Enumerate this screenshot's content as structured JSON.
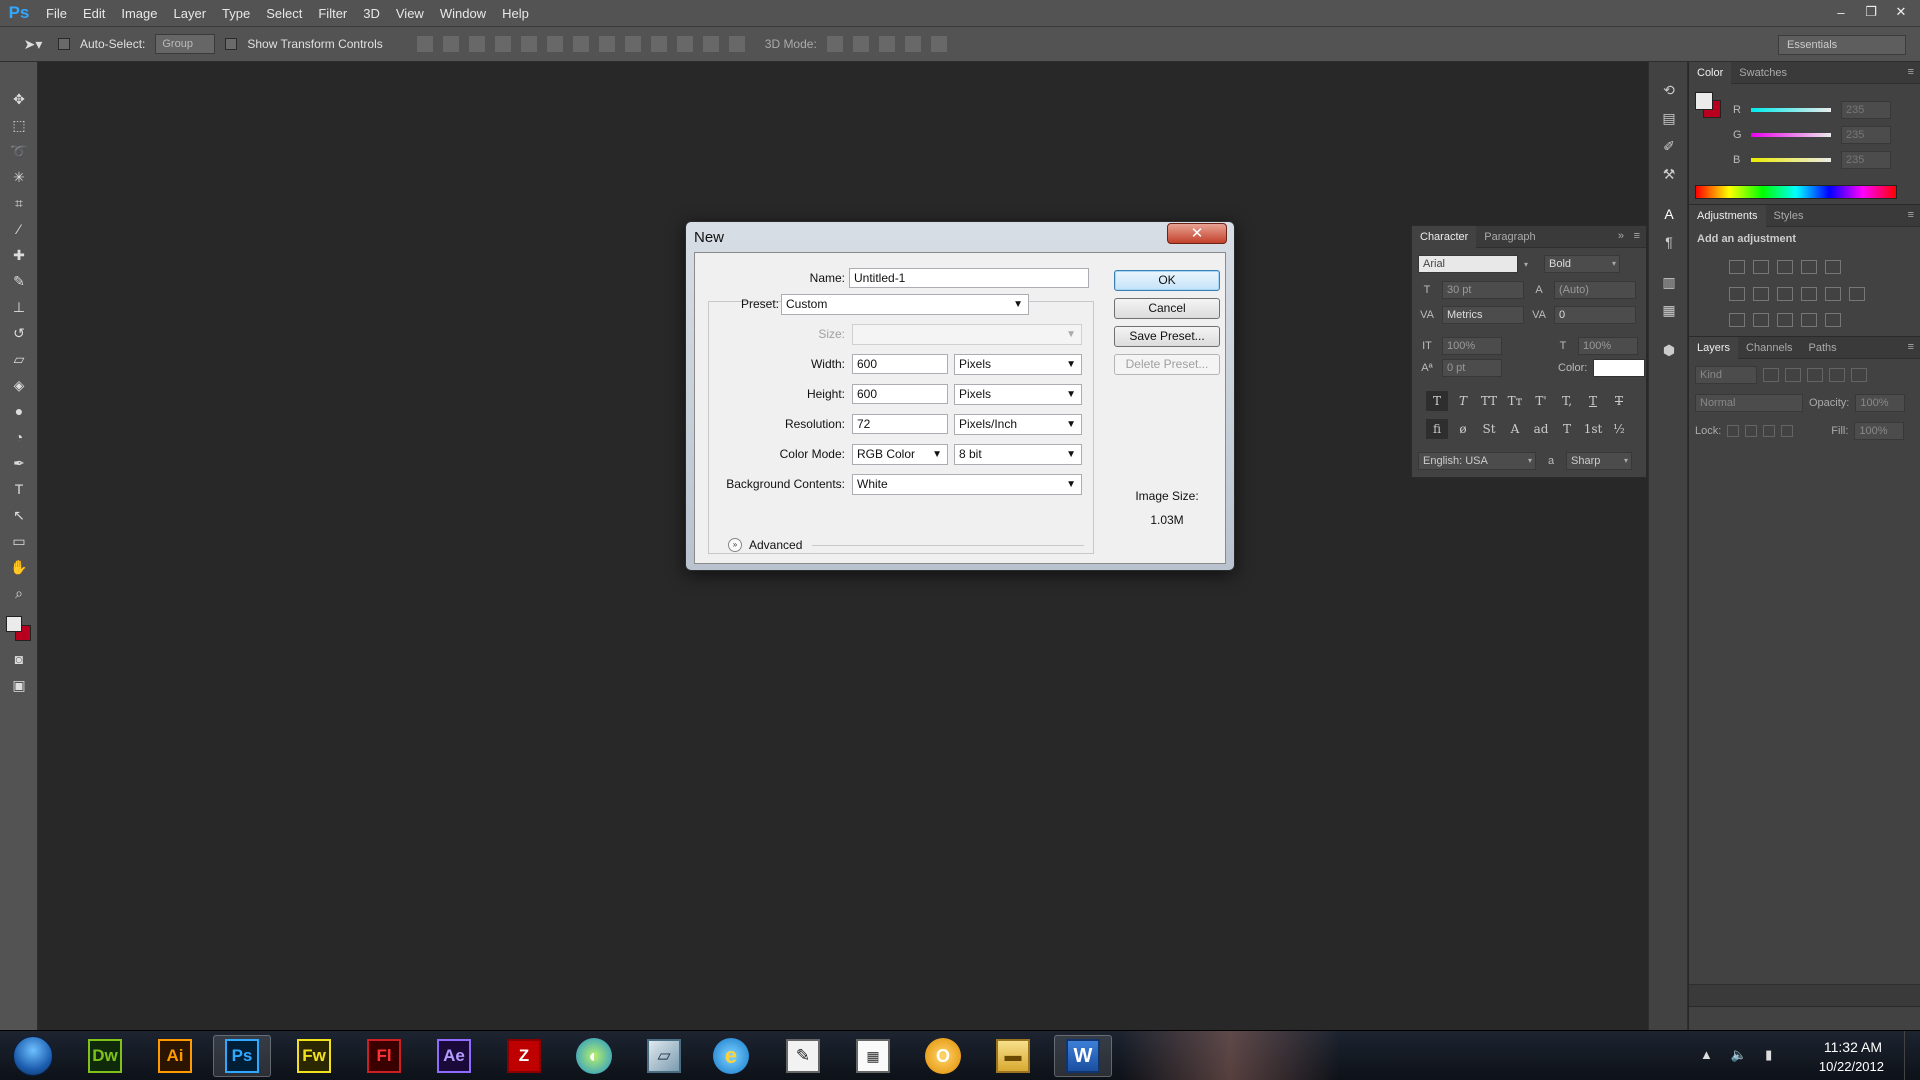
{
  "app": {
    "logo": "Ps"
  },
  "menu": [
    "File",
    "Edit",
    "Image",
    "Layer",
    "Type",
    "Select",
    "Filter",
    "3D",
    "View",
    "Window",
    "Help"
  ],
  "window_controls": {
    "minimize": "–",
    "restore": "❐",
    "close": "✕"
  },
  "options_bar": {
    "auto_select_label": "Auto-Select:",
    "auto_select_value": "Group",
    "show_transform_label": "Show Transform Controls",
    "mode_3d_label": "3D Mode:",
    "workspace": "Essentials"
  },
  "color_panel": {
    "tabs": [
      "Color",
      "Swatches"
    ],
    "channels": [
      {
        "name": "R",
        "value": "235",
        "gradient": "#00c8ff"
      },
      {
        "name": "G",
        "value": "235",
        "gradient": "#ff00ff"
      },
      {
        "name": "B",
        "value": "235",
        "gradient": "#ffff00"
      }
    ],
    "foreground": "#ebebeb",
    "background": "#b8001e"
  },
  "adjustments_panel": {
    "tabs": [
      "Adjustments",
      "Styles"
    ],
    "title": "Add an adjustment"
  },
  "layers_panel": {
    "tabs": [
      "Layers",
      "Channels",
      "Paths"
    ],
    "kind_label": "Kind",
    "blend_mode": "Normal",
    "opacity_label": "Opacity:",
    "opacity_value": "100%",
    "lock_label": "Lock:",
    "fill_label": "Fill:",
    "fill_value": "100%"
  },
  "character_panel": {
    "tabs": [
      "Character",
      "Paragraph"
    ],
    "font_family": "Arial",
    "font_style": "Bold",
    "font_size": "30 pt",
    "leading": "(Auto)",
    "kerning": "Metrics",
    "tracking": "0",
    "vertical_scale": "100%",
    "horizontal_scale": "100%",
    "baseline_shift": "0 pt",
    "color_label": "Color:",
    "language": "English: USA",
    "aa_label": "a",
    "antialias": "Sharp"
  },
  "dialog": {
    "title": "New",
    "close": "✕",
    "name_label": "Name:",
    "name_value": "Untitled-1",
    "preset_label": "Preset:",
    "preset_value": "Custom",
    "size_label": "Size:",
    "width_label": "Width:",
    "width_value": "600",
    "width_unit": "Pixels",
    "height_label": "Height:",
    "height_value": "600",
    "height_unit": "Pixels",
    "resolution_label": "Resolution:",
    "resolution_value": "72",
    "resolution_unit": "Pixels/Inch",
    "color_mode_label": "Color Mode:",
    "color_mode_value": "RGB Color",
    "bit_depth": "8 bit",
    "bg_contents_label": "Background Contents:",
    "bg_contents_value": "White",
    "advanced_label": "Advanced",
    "image_size_label": "Image Size:",
    "image_size_value": "1.03M",
    "buttons": {
      "ok": "OK",
      "cancel": "Cancel",
      "save_preset": "Save Preset...",
      "delete_preset": "Delete Preset..."
    }
  },
  "taskbar": {
    "apps": [
      {
        "label": "Dw",
        "name": "dreamweaver",
        "fg": "#7ec21a",
        "bg": "#0f2a0a",
        "border": "#7ec21a"
      },
      {
        "label": "Ai",
        "name": "illustrator",
        "fg": "#ff9a00",
        "bg": "#2b1500",
        "border": "#ff9a00"
      },
      {
        "label": "Ps",
        "name": "photoshop",
        "fg": "#31a8ff",
        "bg": "#001e36",
        "border": "#31a8ff"
      },
      {
        "label": "Fw",
        "name": "fireworks",
        "fg": "#f2e11e",
        "bg": "#2b2700",
        "border": "#f2e11e"
      },
      {
        "label": "Fl",
        "name": "flash",
        "fg": "#ff3333",
        "bg": "#3a0000",
        "border": "#cc2020"
      },
      {
        "label": "Ae",
        "name": "after-effects",
        "fg": "#b39bff",
        "bg": "#1a0a3a",
        "border": "#8f6bff"
      }
    ],
    "time": "11:32 AM",
    "date": "10/22/2012"
  }
}
